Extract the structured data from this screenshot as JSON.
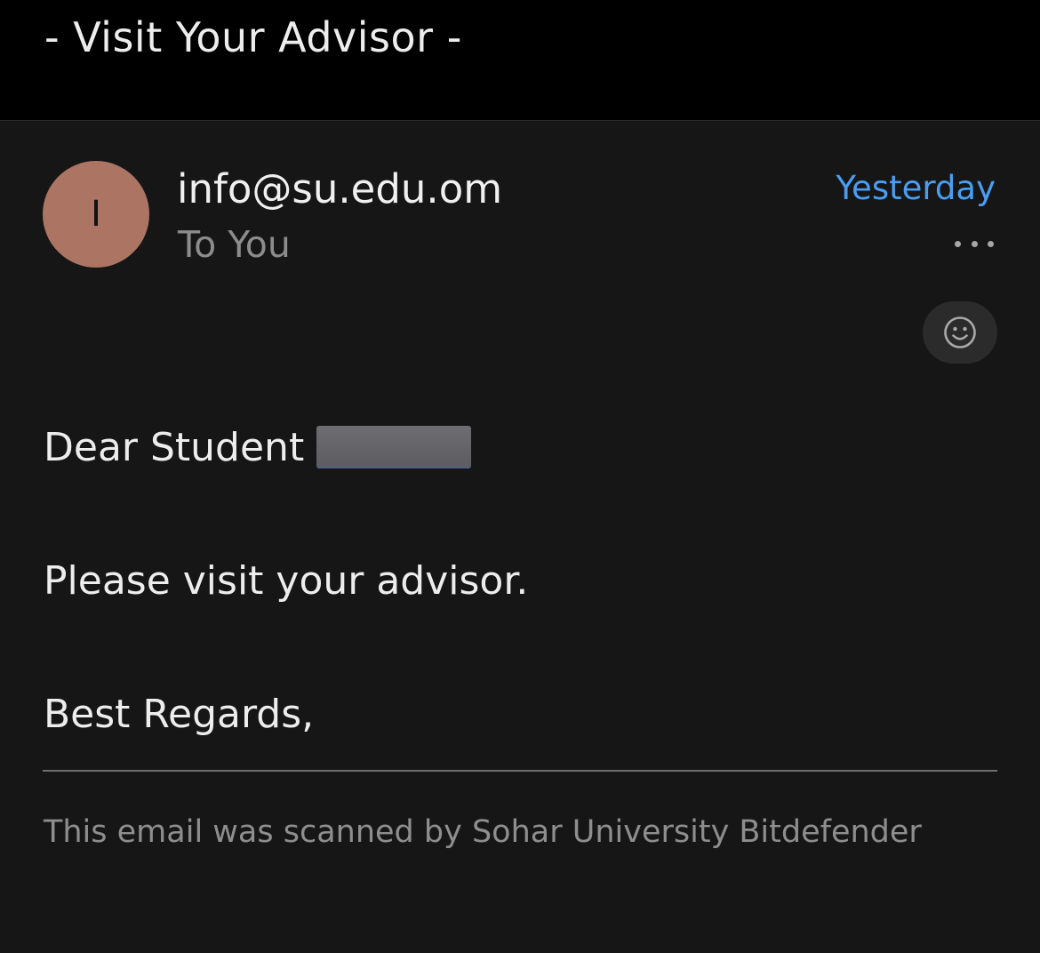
{
  "email": {
    "subject": "- Visit Your Advisor -",
    "avatar_initial": "I",
    "sender": "info@su.edu.om",
    "recipient": "To You",
    "date": "Yesterday",
    "more_icon": "more-horizontal-icon",
    "react_icon": "smiley-face-icon",
    "body": {
      "greeting": "Dear Student",
      "message": "Please visit your advisor.",
      "closing": "Best Regards,"
    },
    "footer": "This email was scanned by Sohar University Bitdefender"
  },
  "colors": {
    "background": "#161616",
    "header_background": "#000000",
    "avatar": "#ac7463",
    "accent": "#4a9ef2",
    "secondary_text": "#8c8c8c"
  }
}
